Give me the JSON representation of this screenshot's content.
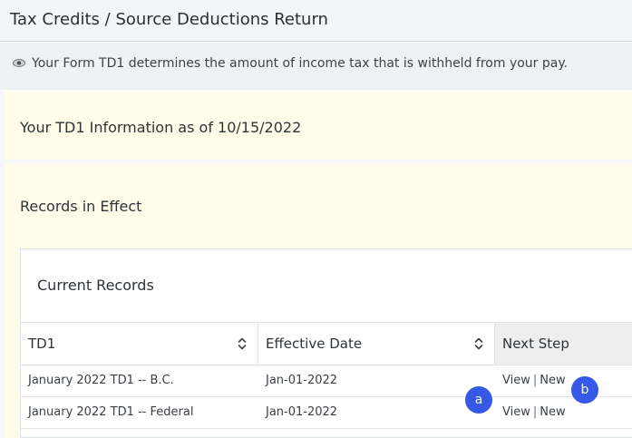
{
  "header": {
    "title": "Tax Credits / Source Deductions Return"
  },
  "info": {
    "icon": "info-eye-icon",
    "text": "Your Form TD1 determines the amount of income tax that is withheld from your pay."
  },
  "td1_info": {
    "title": "Your TD1 Information as of 10/15/2022"
  },
  "records": {
    "section_title": "Records in Effect",
    "card_title": "Current Records",
    "columns": {
      "td1": "TD1",
      "effective_date": "Effective Date",
      "next_step": "Next Step"
    },
    "rows": [
      {
        "td1": "January 2022 TD1 -- B.C.",
        "effective_date": "Jan-01-2022",
        "view_label": "View",
        "separator": "|",
        "new_label": "New"
      },
      {
        "td1": "January 2022 TD1 -- Federal",
        "effective_date": "Jan-01-2022",
        "view_label": "View",
        "separator": "|",
        "new_label": "New"
      }
    ]
  },
  "markers": {
    "a": "a",
    "b": "b"
  },
  "colors": {
    "banner_background": "#fffde9",
    "marker": "#3559e6",
    "next_step_header": "#eeeeee"
  }
}
